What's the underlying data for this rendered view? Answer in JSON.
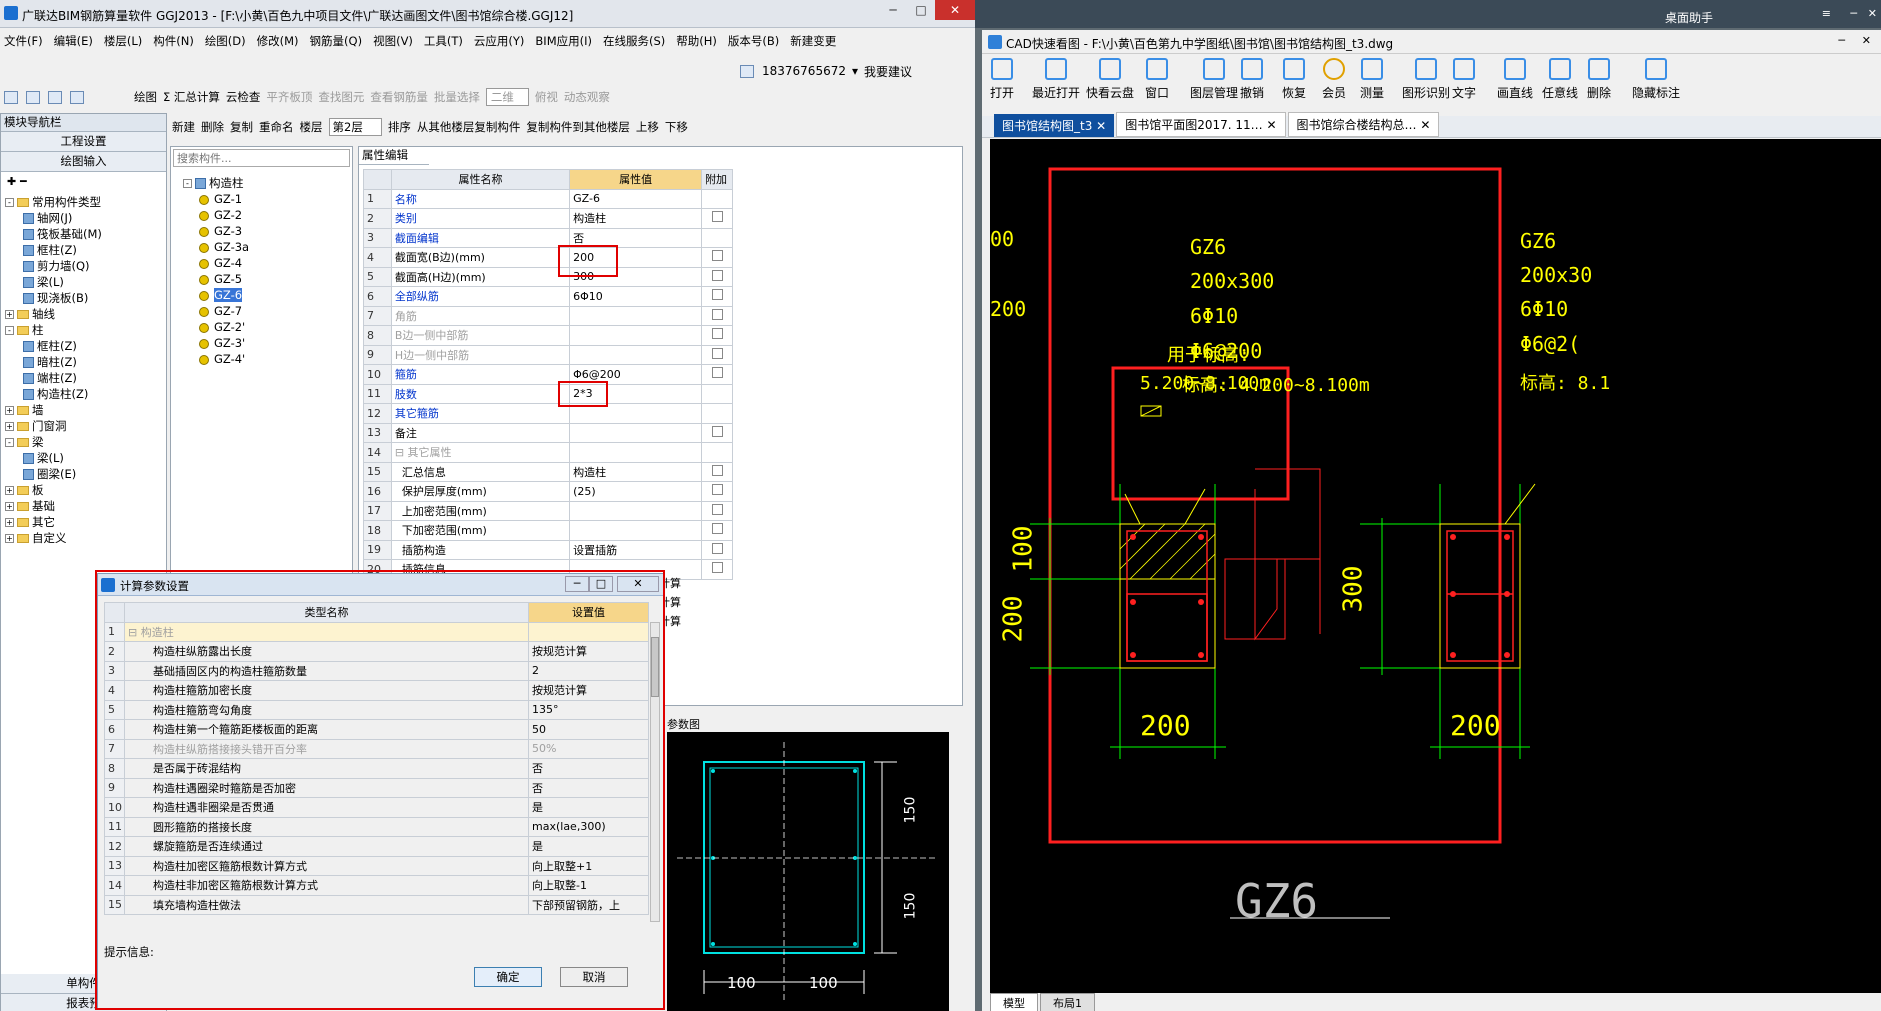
{
  "left_window": {
    "title": "广联达BIM钢筋算量软件 GGJ2013 - [F:\\小黄\\百色九中项目文件\\广联达画图文件\\图书馆综合楼.GGJ12]",
    "menu": [
      "文件(F)",
      "编辑(E)",
      "楼层(L)",
      "构件(N)",
      "绘图(D)",
      "修改(M)",
      "钢筋量(Q)",
      "视图(V)",
      "工具(T)",
      "云应用(Y)",
      "BIM应用(I)",
      "在线服务(S)",
      "帮助(H)",
      "版本号(B)",
      "新建变更"
    ],
    "phone": "18376765672",
    "suggest": "我要建议",
    "toolbar1": [
      "绘图",
      "Σ 汇总计算",
      "云检查",
      "平齐板顶",
      "查找图元",
      "查看钢筋量",
      "批量选择",
      "二维",
      "俯视",
      "动态观察"
    ],
    "toolbar2": [
      "新建",
      "删除",
      "复制",
      "重命名",
      "楼层",
      "第2层",
      "排序",
      "从其他楼层复制构件",
      "复制构件到其他楼层",
      "上移",
      "下移"
    ],
    "nav": {
      "header": "模块导航栏",
      "buttons": [
        "工程设置",
        "绘图输入"
      ],
      "bottom": [
        "单构件",
        "报表预"
      ],
      "tree": [
        {
          "label": "常用构件类型",
          "level": 0,
          "type": "folder",
          "exp": "-"
        },
        {
          "label": "轴网(J)",
          "level": 1,
          "type": "comp"
        },
        {
          "label": "筏板基础(M)",
          "level": 1,
          "type": "comp"
        },
        {
          "label": "框柱(Z)",
          "level": 1,
          "type": "comp"
        },
        {
          "label": "剪力墙(Q)",
          "level": 1,
          "type": "comp"
        },
        {
          "label": "梁(L)",
          "level": 1,
          "type": "comp"
        },
        {
          "label": "现浇板(B)",
          "level": 1,
          "type": "comp"
        },
        {
          "label": "轴线",
          "level": 0,
          "type": "folder",
          "exp": "+"
        },
        {
          "label": "柱",
          "level": 0,
          "type": "folder",
          "exp": "-"
        },
        {
          "label": "框柱(Z)",
          "level": 1,
          "type": "comp"
        },
        {
          "label": "暗柱(Z)",
          "level": 1,
          "type": "comp"
        },
        {
          "label": "端柱(Z)",
          "level": 1,
          "type": "comp"
        },
        {
          "label": "构造柱(Z)",
          "level": 1,
          "type": "comp"
        },
        {
          "label": "墙",
          "level": 0,
          "type": "folder",
          "exp": "+"
        },
        {
          "label": "门窗洞",
          "level": 0,
          "type": "folder",
          "exp": "+"
        },
        {
          "label": "梁",
          "level": 0,
          "type": "folder",
          "exp": "-"
        },
        {
          "label": "梁(L)",
          "level": 1,
          "type": "comp"
        },
        {
          "label": "圈梁(E)",
          "level": 1,
          "type": "comp"
        },
        {
          "label": "板",
          "level": 0,
          "type": "folder",
          "exp": "+"
        },
        {
          "label": "基础",
          "level": 0,
          "type": "folder",
          "exp": "+"
        },
        {
          "label": "其它",
          "level": 0,
          "type": "folder",
          "exp": "+"
        },
        {
          "label": "自定义",
          "level": 0,
          "type": "folder",
          "exp": "+"
        }
      ]
    },
    "search_placeholder": "搜索构件...",
    "component_tree": {
      "root": "构造柱",
      "items": [
        "GZ-1",
        "GZ-2",
        "GZ-3",
        "GZ-3a",
        "GZ-4",
        "GZ-5",
        "GZ-6",
        "GZ-7",
        "GZ-2'",
        "GZ-3'",
        "GZ-4'"
      ],
      "selected": "GZ-6"
    },
    "props": {
      "tab": "属性编辑",
      "headers": [
        "属性名称",
        "属性值",
        "附加"
      ],
      "rows": [
        {
          "n": "1",
          "name": "名称",
          "val": "GZ-6",
          "cls": "blue",
          "chk": false
        },
        {
          "n": "2",
          "name": "类别",
          "val": "构造柱",
          "cls": "blue",
          "chk": true
        },
        {
          "n": "3",
          "name": "截面编辑",
          "val": "否",
          "cls": "blue",
          "chk": false
        },
        {
          "n": "4",
          "name": "截面宽(B边)(mm)",
          "val": "200",
          "cls": "",
          "chk": true
        },
        {
          "n": "5",
          "name": "截面高(H边)(mm)",
          "val": "300",
          "cls": "",
          "chk": true
        },
        {
          "n": "6",
          "name": "全部纵筋",
          "val": "6Φ10",
          "cls": "blue",
          "chk": true
        },
        {
          "n": "7",
          "name": "角筋",
          "val": "",
          "cls": "gray",
          "chk": true
        },
        {
          "n": "8",
          "name": "B边一侧中部筋",
          "val": "",
          "cls": "gray",
          "chk": true
        },
        {
          "n": "9",
          "name": "H边一侧中部筋",
          "val": "",
          "cls": "gray",
          "chk": true
        },
        {
          "n": "10",
          "name": "箍筋",
          "val": "Φ6@200",
          "cls": "blue",
          "chk": true
        },
        {
          "n": "11",
          "name": "肢数",
          "val": "2*3",
          "cls": "blue",
          "chk": false
        },
        {
          "n": "12",
          "name": "其它箍筋",
          "val": "",
          "cls": "blue",
          "chk": false
        },
        {
          "n": "13",
          "name": "备注",
          "val": "",
          "cls": "",
          "chk": true
        },
        {
          "n": "14",
          "name": "⊟ 其它属性",
          "val": "",
          "cls": "gray",
          "chk": false
        },
        {
          "n": "15",
          "name": "  汇总信息",
          "val": "构造柱",
          "cls": "",
          "chk": true
        },
        {
          "n": "16",
          "name": "  保护层厚度(mm)",
          "val": "(25)",
          "cls": "",
          "chk": true
        },
        {
          "n": "17",
          "name": "  上加密范围(mm)",
          "val": "",
          "cls": "",
          "chk": true
        },
        {
          "n": "18",
          "name": "  下加密范围(mm)",
          "val": "",
          "cls": "",
          "chk": true
        },
        {
          "n": "19",
          "name": "  插筋构造",
          "val": "设置插筋",
          "cls": "",
          "chk": true
        },
        {
          "n": "20",
          "name": "  插筋信息",
          "val": "",
          "cls": "",
          "chk": true
        }
      ],
      "peek": [
        "计算",
        "计算",
        "计算"
      ]
    },
    "param_label": "参数图",
    "param_dims": {
      "d150a": "150",
      "d150b": "150",
      "d100a": "100",
      "d100b": "100"
    }
  },
  "dialog": {
    "title": "计算参数设置",
    "headers": [
      "类型名称",
      "设置值"
    ],
    "rows": [
      {
        "n": "1",
        "name": "⊟ 构造柱",
        "val": "",
        "grp": true
      },
      {
        "n": "2",
        "name": "构造柱纵筋露出长度",
        "val": "按规范计算"
      },
      {
        "n": "3",
        "name": "基础插固区内的构造柱箍筋数量",
        "val": "2"
      },
      {
        "n": "4",
        "name": "构造柱箍筋加密长度",
        "val": "按规范计算"
      },
      {
        "n": "5",
        "name": "构造柱箍筋弯勾角度",
        "val": "135°"
      },
      {
        "n": "6",
        "name": "构造柱第一个箍筋距楼板面的距离",
        "val": "50"
      },
      {
        "n": "7",
        "name": "构造柱纵筋搭接接头错开百分率",
        "val": "50%",
        "gray": true
      },
      {
        "n": "8",
        "name": "是否属于砖混结构",
        "val": "否"
      },
      {
        "n": "9",
        "name": "构造柱遇圈梁时箍筋是否加密",
        "val": "否"
      },
      {
        "n": "10",
        "name": "构造柱遇非圈梁是否贯通",
        "val": "是"
      },
      {
        "n": "11",
        "name": "圆形箍筋的搭接长度",
        "val": "max(lae,300)"
      },
      {
        "n": "12",
        "name": "螺旋箍筋是否连续通过",
        "val": "是"
      },
      {
        "n": "13",
        "name": "构造柱加密区箍筋根数计算方式",
        "val": "向上取整+1"
      },
      {
        "n": "14",
        "name": "构造柱非加密区箍筋根数计算方式",
        "val": "向上取整-1"
      },
      {
        "n": "15",
        "name": "填充墙构造柱做法",
        "val": "下部预留钢筋，上"
      }
    ],
    "hint": "提示信息:",
    "ok": "确定",
    "cancel": "取消"
  },
  "right_window": {
    "title": "CAD快速看图 - F:\\小黄\\百色第九中学图纸\\图书馆\\图书馆结构图_t3.dwg",
    "taskbar_label": "桌面助手",
    "tools": [
      "打开",
      "最近打开",
      "快看云盘",
      "窗口",
      "图层管理",
      "撤销",
      "恢复",
      "会员",
      "测量",
      "图形识别",
      "文字",
      "画直线",
      "任意线",
      "删除",
      "隐藏标注"
    ],
    "tabs": [
      "图书馆结构图_t3",
      "图书馆平面图2017. 11…",
      "图书馆综合楼结构总…"
    ],
    "bottom_tabs": [
      "模型",
      "布局1"
    ],
    "drawing": {
      "left_cut": [
        "00",
        "200"
      ],
      "gz_left": {
        "name": "GZ6",
        "size": "200x300",
        "long_bar": "6Φ10",
        "stirrup": "Φ6@200",
        "elev": "标高: 4.200~8.100m"
      },
      "note": {
        "label": "用于标高:",
        "range": "5.200~8.100m"
      },
      "dims_left": {
        "d100": "100",
        "d200": "200",
        "bottom": "200"
      },
      "gz_right": {
        "name": "GZ6",
        "size": "200x30",
        "long_bar": "6Φ10",
        "stirrup": "Φ6@2(",
        "elev": "标高: 8.1"
      },
      "dims_right": {
        "side": "300",
        "bottom": "200"
      },
      "big_label": "GZ6"
    }
  }
}
